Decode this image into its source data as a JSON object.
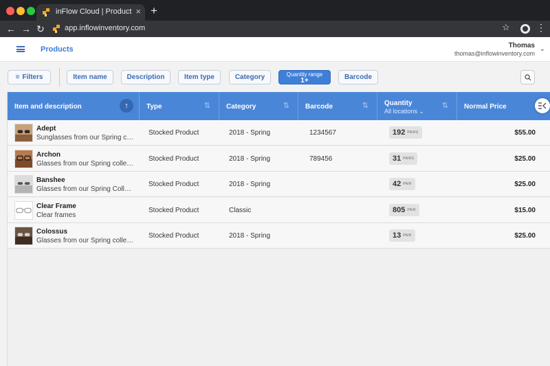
{
  "browser": {
    "tab_title": "inFlow Cloud | Product",
    "tab_close": "×",
    "new_tab": "+",
    "url": "app.inflowinventory.com",
    "back": "←",
    "forward": "→",
    "reload": "↻",
    "star": "☆",
    "menu": "⋮"
  },
  "header": {
    "title": "Products",
    "user_name": "Thomas",
    "user_email": "thomas@inflowinventory.com"
  },
  "filters": {
    "filters_label": "Filters",
    "chips": [
      "Item name",
      "Description",
      "Item type",
      "Category"
    ],
    "active_label": "Quantity range",
    "active_value": "1+",
    "barcode_label": "Barcode"
  },
  "table": {
    "columns": {
      "item": "Item and description",
      "type": "Type",
      "category": "Category",
      "barcode": "Barcode",
      "quantity": "Quantity",
      "quantity_sub": "All locations ⌄",
      "price": "Normal Price"
    },
    "rows": [
      {
        "name": "Adept",
        "desc": "Sunglasses from our Spring coll...",
        "type": "Stocked Product",
        "category": "2018 - Spring",
        "barcode": "1234567",
        "qty": "192",
        "unit": "PAIRS",
        "price": "$55.00"
      },
      {
        "name": "Archon",
        "desc": "Glasses from our Spring collecti...",
        "type": "Stocked Product",
        "category": "2018 - Spring",
        "barcode": "789456",
        "qty": "31",
        "unit": "PAIRS",
        "price": "$25.00"
      },
      {
        "name": "Banshee",
        "desc": "Glasses from our Spring Collecti...",
        "type": "Stocked Product",
        "category": "2018 - Spring",
        "barcode": "",
        "qty": "42",
        "unit": "PAIR",
        "price": "$25.00"
      },
      {
        "name": "Clear Frame",
        "desc": "Clear frames",
        "type": "Stocked Product",
        "category": "Classic",
        "barcode": "",
        "qty": "805",
        "unit": "PAIR",
        "price": "$15.00"
      },
      {
        "name": "Colossus",
        "desc": "Glasses from our Spring collecti...",
        "type": "Stocked Product",
        "category": "2018 - Spring",
        "barcode": "",
        "qty": "13",
        "unit": "PAIR",
        "price": "$25.00"
      }
    ]
  },
  "colors": {
    "accent": "#4a86d8",
    "active_chip": "#3f7fd7",
    "title_blue": "#3d7bd8"
  }
}
